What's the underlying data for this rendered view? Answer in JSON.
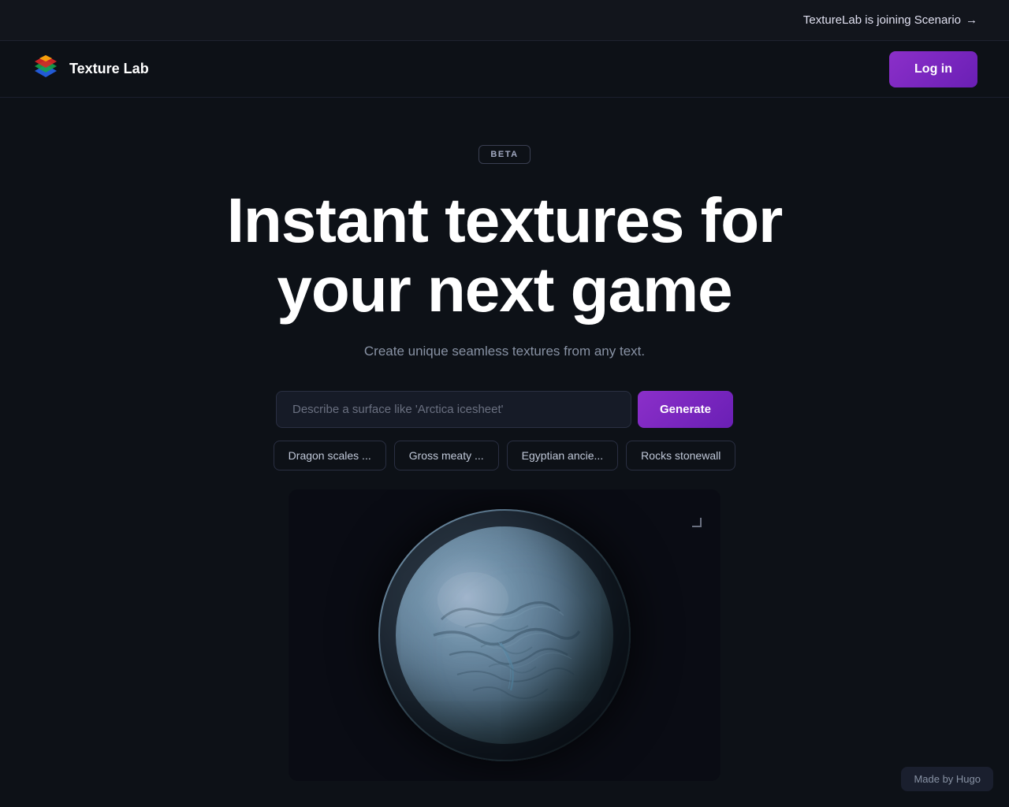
{
  "announcement": {
    "text": "TextureLab is joining Scenario",
    "arrow": "→"
  },
  "nav": {
    "logo_text": "Texture Lab",
    "login_label": "Log in"
  },
  "hero": {
    "beta_label": "BETA",
    "title_line1": "Instant textures for",
    "title_line2": "your next game",
    "subtitle": "Create unique seamless textures from any text.",
    "search_placeholder": "Describe a surface like 'Arctica icesheet'",
    "generate_label": "Generate"
  },
  "chips": [
    {
      "label": "Dragon scales ...",
      "id": "dragon-scales"
    },
    {
      "label": "Gross meaty ...",
      "id": "gross-meaty"
    },
    {
      "label": "Egyptian ancie...",
      "id": "egyptian-ancient"
    },
    {
      "label": "Rocks stonewall",
      "id": "rocks-stonewall"
    }
  ],
  "preview": {
    "alt": "3D sphere with brain/ice texture preview"
  },
  "footer": {
    "made_by": "Made by Hugo"
  }
}
